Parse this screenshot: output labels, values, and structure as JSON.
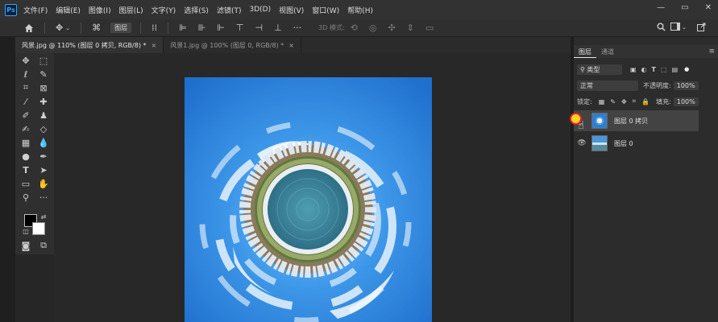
{
  "menubar": {
    "logo": "Ps",
    "items": [
      "文件(F)",
      "编辑(E)",
      "图像(I)",
      "图层(L)",
      "文字(Y)",
      "选择(S)",
      "滤镜(T)",
      "3D(D)",
      "视图(V)",
      "窗口(W)",
      "帮助(H)"
    ],
    "window_controls": [
      "—",
      "▭",
      "✕"
    ]
  },
  "options": {
    "layer_select": "图层",
    "mode_3d": "3D 模式:"
  },
  "tabs": [
    {
      "label": "风景.jpg @ 110% (图层 0 拷贝, RGB/8) *",
      "close": "×"
    },
    {
      "label": "风景1.jpg @ 100% (图层 0, RGB/8) *",
      "close": "×"
    }
  ],
  "layers_panel": {
    "tabs": [
      "图层",
      "通道"
    ],
    "filter_kind": "类型",
    "blend_mode": "正常",
    "opacity_label": "不透明度:",
    "opacity_value": "100%",
    "lock_label": "锁定:",
    "fill_label": "填充:",
    "fill_value": "100%",
    "layers": [
      {
        "name": "图层 0 拷贝",
        "selected": true
      },
      {
        "name": "图层 0",
        "selected": false
      }
    ]
  },
  "colors": {
    "accent": "#31a8ff",
    "sky": "#3a8fe0",
    "highlight_dot": "#ffd21f"
  }
}
